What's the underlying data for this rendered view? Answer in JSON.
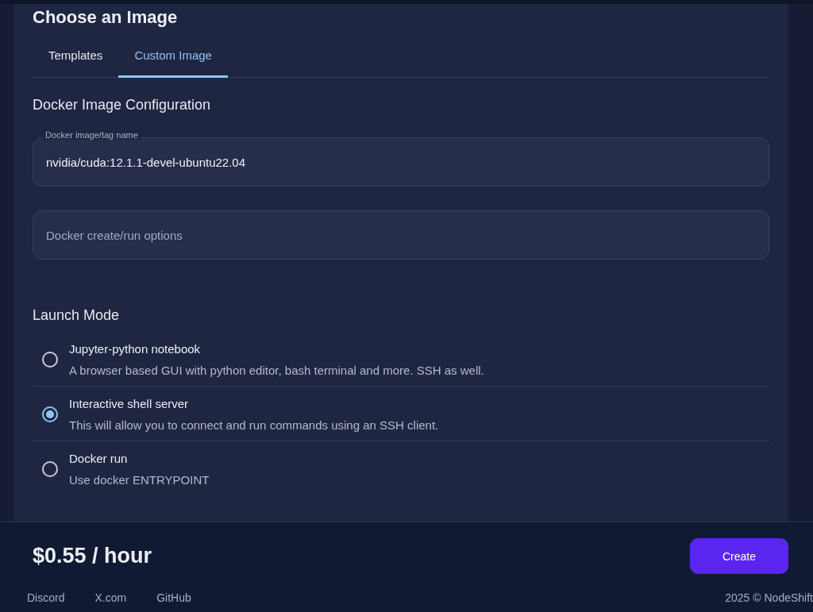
{
  "title": "Choose an Image",
  "tabs": [
    {
      "label": "Templates",
      "selected": false
    },
    {
      "label": "Custom Image",
      "selected": true
    }
  ],
  "section_title": "Docker Image Configuration",
  "fields": [
    {
      "label": "Docker image/tag name",
      "value": "nvidia/cuda:12.1.1-devel-ubuntu22.04"
    },
    {
      "placeholder": "Docker create/run options"
    }
  ],
  "launch_mode": {
    "title": "Launch Mode",
    "options": [
      {
        "title": "Jupyter-python notebook",
        "description": "A browser based GUI with python editor, bash terminal and more. SSH as well.",
        "selected": false
      },
      {
        "title": "Interactive shell server",
        "description": "This will allow you to connect and run commands using an SSH client.",
        "selected": true
      },
      {
        "title": "Docker run",
        "description": "Use docker ENTRYPOINT",
        "selected": false
      }
    ]
  },
  "price": "$0.55 / hour",
  "create_button": "Create",
  "footer_links": [
    "Discord",
    "X.com",
    "GitHub"
  ],
  "copyright": "2025 © NodeShift"
}
